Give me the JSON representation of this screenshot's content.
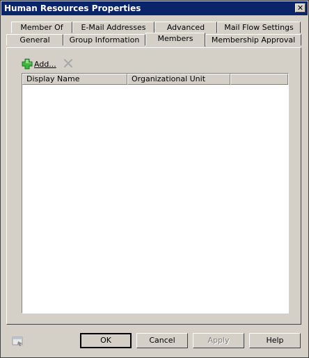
{
  "window": {
    "title": "Human Resources Properties",
    "close_glyph": "✕"
  },
  "tabs_row1": [
    {
      "label": "Member Of"
    },
    {
      "label": "E-Mail Addresses"
    },
    {
      "label": "Advanced"
    },
    {
      "label": "Mail Flow Settings"
    }
  ],
  "tabs_row2": [
    {
      "label": "General"
    },
    {
      "label": "Group Information"
    },
    {
      "label": "Members",
      "active": true
    },
    {
      "label": "Membership Approval"
    }
  ],
  "toolbar": {
    "add_label": "Add...",
    "add_icon": "green-plus-icon",
    "remove_icon": "remove-x-icon",
    "remove_enabled": false
  },
  "list": {
    "columns": [
      {
        "label": "Display Name"
      },
      {
        "label": "Organizational Unit"
      },
      {
        "label": ""
      }
    ],
    "rows": []
  },
  "buttons": {
    "ok": "OK",
    "cancel": "Cancel",
    "apply": "Apply",
    "help": "Help"
  }
}
